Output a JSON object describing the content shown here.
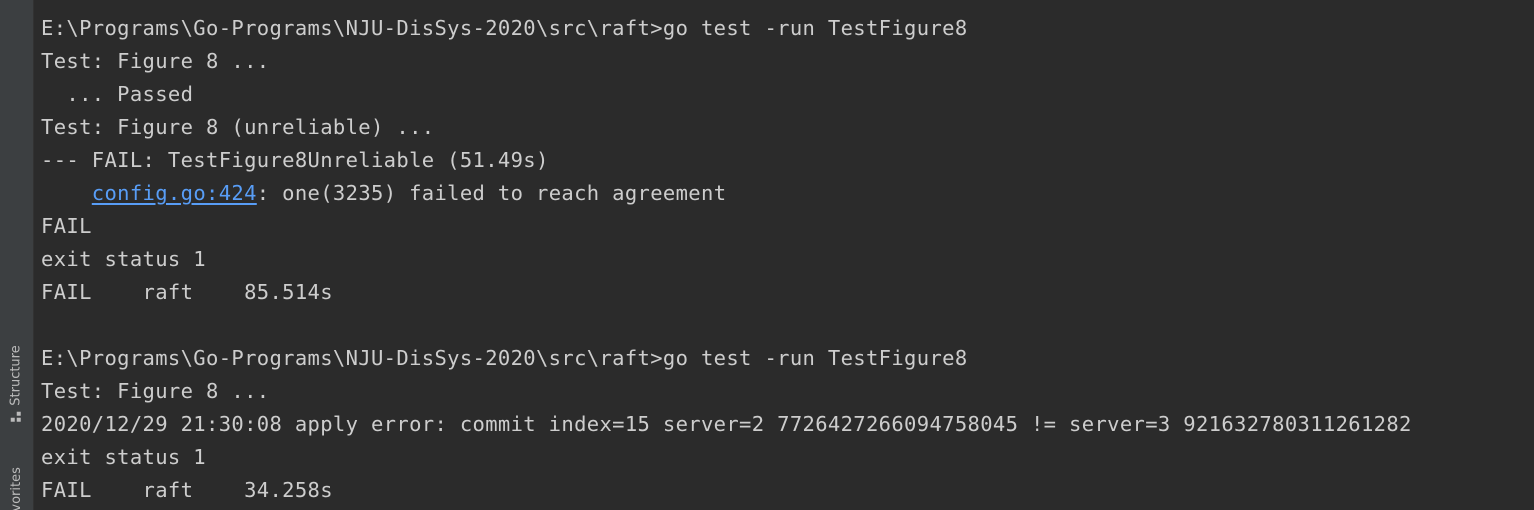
{
  "sidebar": {
    "structure_label": "Structure",
    "favorites_label": "Favorites"
  },
  "terminal": {
    "run1": {
      "command": "E:\\Programs\\Go-Programs\\NJU-DisSys-2020\\src\\raft>go test -run TestFigure8",
      "line2": "Test: Figure 8 ...",
      "line3": "  ... Passed",
      "line4": "Test: Figure 8 (unreliable) ...",
      "line5": "--- FAIL: TestFigure8Unreliable (51.49s)",
      "line6_indent": "    ",
      "line6_link": "config.go:424",
      "line6_rest": ": one(3235) failed to reach agreement",
      "line7": "FAIL",
      "line8": "exit status 1",
      "line9": "FAIL    raft    85.514s"
    },
    "run2": {
      "command": "E:\\Programs\\Go-Programs\\NJU-DisSys-2020\\src\\raft>go test -run TestFigure8",
      "line2": "Test: Figure 8 ...",
      "line3": "2020/12/29 21:30:08 apply error: commit index=15 server=2 7726427266094758045 != server=3 921632780311261282",
      "line4": "exit status 1",
      "line5": "FAIL    raft    34.258s"
    }
  },
  "colors": {
    "background": "#2b2b2b",
    "text": "#cdcdcd",
    "link": "#589df6",
    "sidebar": "#3c3f41"
  }
}
